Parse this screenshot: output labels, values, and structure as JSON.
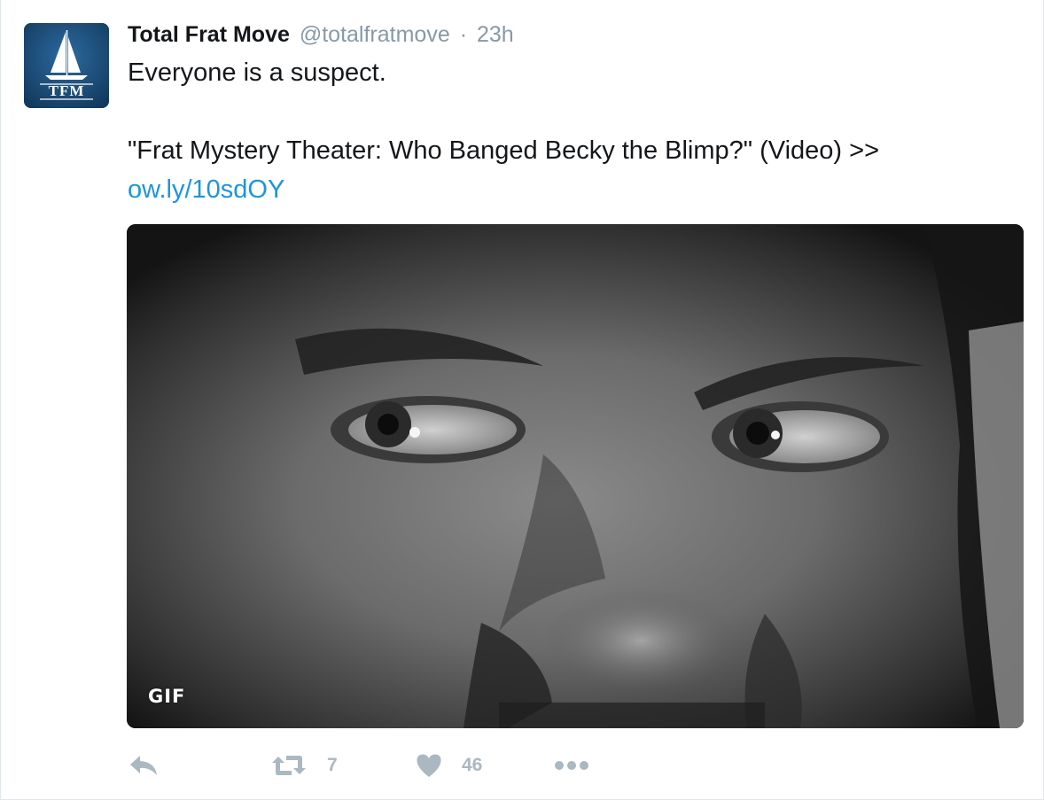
{
  "tweet": {
    "author_name": "Total Frat Move",
    "author_handle": "@totalfratmove",
    "separator": "·",
    "time": "23h",
    "text_line1": "Everyone is a suspect.",
    "text_line2": "\"Frat Mystery Theater: Who Banged Becky the Blimp?\" (Video) >>",
    "link_text": "ow.ly/10sdOY",
    "avatar_logo_text": "TFM",
    "media_badge": "GIF",
    "retweet_count": "7",
    "like_count": "46"
  },
  "icons": {
    "avatar": "sailboat-logo",
    "reply": "reply-icon",
    "retweet": "retweet-icon",
    "like": "heart-icon",
    "more": "more-dots-icon"
  },
  "colors": {
    "text": "#14171a",
    "muted": "#8899a6",
    "link": "#1b95e0",
    "action_icon": "#aab8c2",
    "avatar_bg": "#1d4f7a"
  }
}
